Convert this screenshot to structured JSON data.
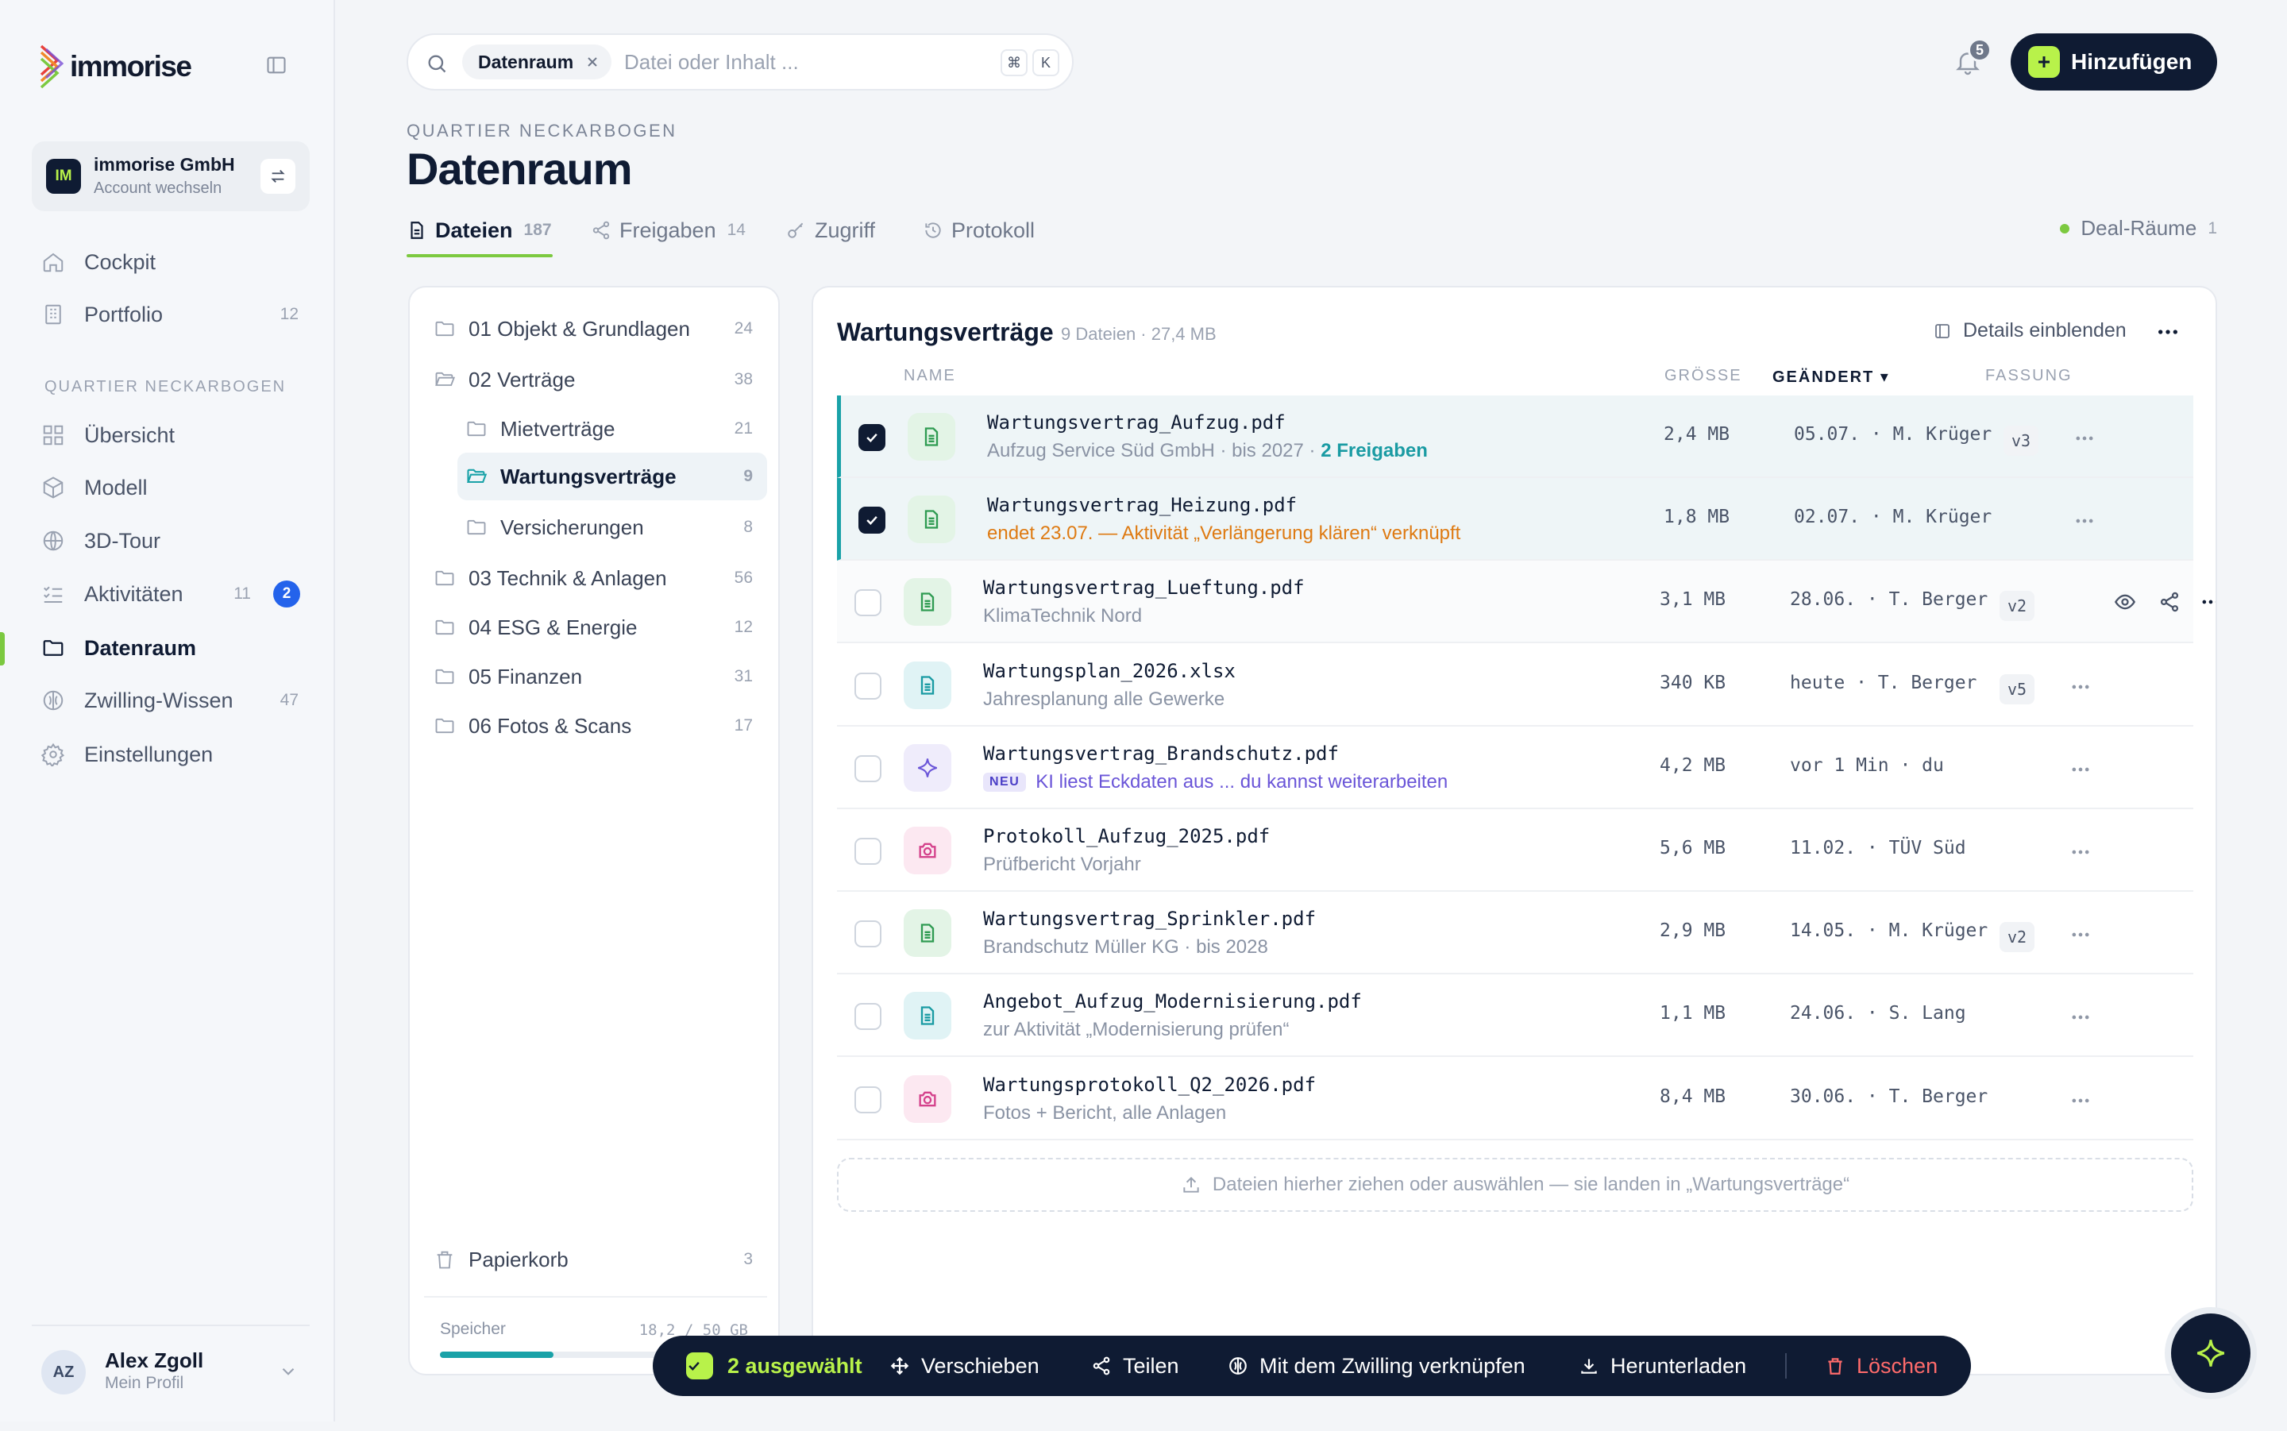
{
  "brand": {
    "name": "immorise"
  },
  "account": {
    "initials": "IM",
    "name": "immorise GmbH",
    "sub": "Account wechseln"
  },
  "nav_top": [
    {
      "label": "Cockpit",
      "count": ""
    },
    {
      "label": "Portfolio",
      "count": "12"
    }
  ],
  "nav_section_label": "QUARTIER NECKARBOGEN",
  "nav_section": [
    {
      "label": "Übersicht",
      "count": ""
    },
    {
      "label": "Modell",
      "count": ""
    },
    {
      "label": "3D-Tour",
      "count": ""
    },
    {
      "label": "Aktivitäten",
      "count": "11",
      "badge": "2"
    },
    {
      "label": "Datenraum",
      "count": "",
      "active": true
    },
    {
      "label": "Zwilling-Wissen",
      "count": "47"
    },
    {
      "label": "Einstellungen",
      "count": ""
    }
  ],
  "profile": {
    "initials": "AZ",
    "name": "Alex Zgoll",
    "sub": "Mein Profil"
  },
  "search": {
    "chip": "Datenraum",
    "placeholder": "Datei oder Inhalt ...",
    "kbd1": "⌘",
    "kbd2": "K"
  },
  "notifications": {
    "count": "5"
  },
  "add_button": {
    "label": "Hinzufügen"
  },
  "header": {
    "kicker": "QUARTIER NECKARBOGEN",
    "title": "Datenraum"
  },
  "tabs": [
    {
      "label": "Dateien",
      "count": "187",
      "active": true
    },
    {
      "label": "Freigaben",
      "count": "14"
    },
    {
      "label": "Zugriff",
      "count": ""
    },
    {
      "label": "Protokoll",
      "count": ""
    }
  ],
  "deal_rooms": {
    "label": "Deal-Räume",
    "count": "1",
    "status_color": "#7cc940"
  },
  "folders": [
    {
      "label": "01 Objekt & Grundlagen",
      "count": "24"
    },
    {
      "label": "02 Verträge",
      "count": "38",
      "open": true
    },
    {
      "label": "Mietverträge",
      "count": "21"
    },
    {
      "label": "Wartungsverträge",
      "count": "9",
      "selected": true
    },
    {
      "label": "Versicherungen",
      "count": "8"
    },
    {
      "label": "03 Technik & Anlagen",
      "count": "56"
    },
    {
      "label": "04 ESG & Energie",
      "count": "12"
    },
    {
      "label": "05 Finanzen",
      "count": "31"
    },
    {
      "label": "06 Fotos & Scans",
      "count": "17"
    }
  ],
  "trash": {
    "label": "Papierkorb",
    "count": "3"
  },
  "storage": {
    "label": "Speicher",
    "value": "18,2 / 50 GB",
    "used_fraction": 0.364
  },
  "folder_view": {
    "title": "Wartungsverträge",
    "sub": "9 Dateien · 27,4 MB",
    "details_label": "Details einblenden",
    "columns": {
      "name": "NAME",
      "size": "GRÖSSE",
      "modified": "GEÄNDERT ▾",
      "version": "FASSUNG"
    },
    "files": [
      {
        "name": "Wartungsvertrag_Aufzug.pdf",
        "sub": "Aufzug Service Süd GmbH · bis 2027 · ",
        "link": "2 Freigaben",
        "size": "2,4 MB",
        "modified": "05.07. · M. Krüger",
        "version": "v3",
        "icon": "doc-icon",
        "tone": "green",
        "selected": true
      },
      {
        "name": "Wartungsvertrag_Heizung.pdf",
        "sub": "endet 23.07. — Aktivität „Verlängerung klären“ verknüpft",
        "link": "",
        "size": "1,8 MB",
        "modified": "02.07. · M. Krüger",
        "version": "",
        "icon": "doc-icon",
        "tone": "green",
        "selected": true,
        "sub_style": "warn"
      },
      {
        "name": "Wartungsvertrag_Lueftung.pdf",
        "sub": "KlimaTechnik Nord",
        "link": "",
        "size": "3,1 MB",
        "modified": "28.06. · T. Berger",
        "version": "v2",
        "icon": "doc-icon",
        "tone": "green",
        "hover": true
      },
      {
        "name": "Wartungsplan_2026.xlsx",
        "sub": "Jahresplanung alle Gewerke",
        "link": "",
        "size": "340 KB",
        "modified": "heute · T. Berger",
        "version": "v5",
        "icon": "doc-icon",
        "tone": "teal"
      },
      {
        "name": "Wartungsvertrag_Brandschutz.pdf",
        "sub": "KI liest Eckdaten aus ... du kannst weiterarbeiten",
        "link": "",
        "size": "4,2 MB",
        "modified": "vor 1 Min · du",
        "version": "",
        "icon": "sparkle-icon",
        "tone": "purple",
        "tag": "NEU",
        "sub_style": "ki"
      },
      {
        "name": "Protokoll_Aufzug_2025.pdf",
        "sub": "Prüfbericht Vorjahr",
        "link": "",
        "size": "5,6 MB",
        "modified": "11.02. · TÜV Süd",
        "version": "",
        "icon": "camera-icon",
        "tone": "pink"
      },
      {
        "name": "Wartungsvertrag_Sprinkler.pdf",
        "sub": "Brandschutz Müller KG · bis 2028",
        "link": "",
        "size": "2,9 MB",
        "modified": "14.05. · M. Krüger",
        "version": "v2",
        "icon": "doc-icon",
        "tone": "green"
      },
      {
        "name": "Angebot_Aufzug_Modernisierung.pdf",
        "sub": "zur Aktivität „Modernisierung prüfen“",
        "link": "",
        "size": "1,1 MB",
        "modified": "24.06. · S. Lang",
        "version": "",
        "icon": "doc-icon",
        "tone": "teal"
      },
      {
        "name": "Wartungsprotokoll_Q2_2026.pdf",
        "sub": "Fotos + Bericht, alle Anlagen",
        "link": "",
        "size": "8,4 MB",
        "modified": "30.06. · T. Berger",
        "version": "",
        "icon": "camera-icon",
        "tone": "pink"
      }
    ],
    "dropzone": "Dateien hierher ziehen oder auswählen — sie landen in „Wartungsverträge“"
  },
  "bulk_bar": {
    "selected": "2 ausgewählt",
    "move": "Verschieben",
    "share": "Teilen",
    "link_twin": "Mit dem Zwilling verknüpfen",
    "download": "Herunterladen",
    "delete": "Löschen"
  },
  "colors": {
    "accent_lime": "#b8f24a",
    "navy": "#0f1b33",
    "teal": "#1aa2a8",
    "green": "#7cc940",
    "warning": "#de7a12",
    "danger": "#ff6b6b"
  }
}
